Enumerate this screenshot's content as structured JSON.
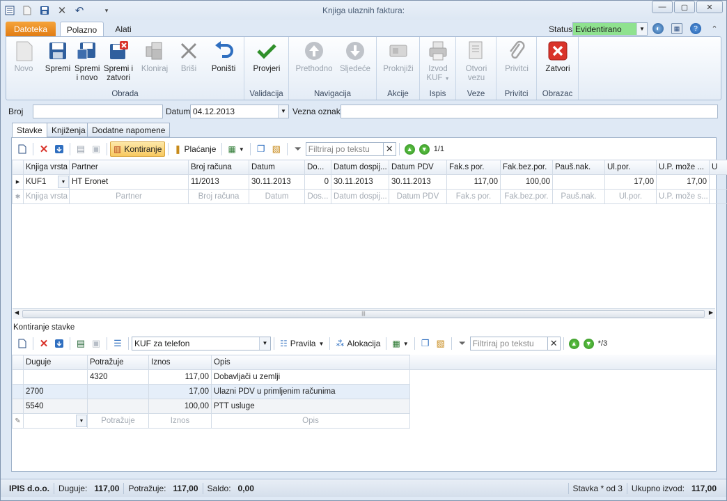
{
  "window": {
    "title": "Knjiga ulaznih faktura:",
    "min_symbol": "—",
    "max_symbol": "▢",
    "close_symbol": "✕"
  },
  "ribbon_tabs": [
    "Datoteka",
    "Polazno",
    "Alati"
  ],
  "status": {
    "label": "Status",
    "value": "Evidentirano"
  },
  "ribbon": {
    "groups": [
      "Obrada",
      "Validacija",
      "Navigacija",
      "Akcije",
      "Ispis",
      "Veze",
      "Privitci",
      "Obrazac"
    ],
    "novo": "Novo",
    "spremi": "Spremi",
    "spremi_novo": [
      "Spremi",
      "i novo"
    ],
    "spremi_zatvori": [
      "Spremi i",
      "zatvori"
    ],
    "kloniraj": "Kloniraj",
    "brisi": "Briši",
    "ponisti": "Poništi",
    "provjeri": "Provjeri",
    "prethodno": "Prethodno",
    "sljedece": "Sljedeće",
    "proknjizi": "Proknjiži",
    "izvod_kuf": [
      "Izvod",
      "KUF"
    ],
    "otvori_vezu": [
      "Otvori",
      "vezu"
    ],
    "privitci": "Privitci",
    "zatvori": "Zatvori"
  },
  "form": {
    "broj_label": "Broj",
    "broj_value": "",
    "datum_label": "Datum",
    "datum_value": "04.12.2013",
    "vezna_label": "Vezna oznaka",
    "vezna_value": ""
  },
  "page_tabs": [
    "Stavke",
    "Knjiženja",
    "Dodatne napomene"
  ],
  "stavke_toolbar": {
    "kontiranje": "Kontiranje",
    "placanje": "Plaćanje",
    "filter_placeholder": "Filtriraj po tekstu",
    "pager": "1/1"
  },
  "stavke_grid": {
    "columns": [
      "Knjiga vrsta",
      "Partner",
      "Broj računa",
      "Datum",
      "Do...",
      "Datum dospij...",
      "Datum PDV",
      "Fak.s por.",
      "Fak.bez.por.",
      "Pauš.nak.",
      "Ul.por.",
      "U.P. može ...",
      "U"
    ],
    "row": [
      "KUF1",
      "HT Eronet",
      "11/2013",
      "30.11.2013",
      "0",
      "30.11.2013",
      "30.11.2013",
      "117,00",
      "100,00",
      "",
      "17,00",
      "17,00"
    ],
    "new_row": [
      "Knjiga vrsta",
      "Partner",
      "Broj računa",
      "Datum",
      "Dos...",
      "Datum dospij...",
      "Datum PDV",
      "Fak.s por.",
      "Fak.bez.por.",
      "Pauš.nak.",
      "Ul.por.",
      "U.P. može s..."
    ]
  },
  "kontiranje": {
    "title": "Kontiranje stavke",
    "template": "KUF za telefon",
    "pravila": "Pravila",
    "alokacija": "Alokacija",
    "filter_placeholder": "Filtriraj po tekstu",
    "pager": "*/3",
    "columns": [
      "Duguje",
      "Potražuje",
      "Iznos",
      "Opis"
    ],
    "rows": [
      {
        "duguje": "",
        "potrazuje": "4320",
        "iznos": "117,00",
        "opis": "Dobavljači u zemlji"
      },
      {
        "duguje": "2700",
        "potrazuje": "",
        "iznos": "17,00",
        "opis": "Ulazni PDV u primljenim računima"
      },
      {
        "duguje": "5540",
        "potrazuje": "",
        "iznos": "100,00",
        "opis": "PTT usluge"
      }
    ],
    "new_row": {
      "potrazuje": "Potražuje",
      "iznos": "Iznos",
      "opis": "Opis"
    }
  },
  "statusbar": {
    "company": "IPIS d.o.o.",
    "duguje_label": "Duguje:",
    "duguje_value": "117,00",
    "potrazuje_label": "Potražuje:",
    "potrazuje_value": "117,00",
    "saldo_label": "Saldo:",
    "saldo_value": "0,00",
    "stavka": "Stavka * od 3",
    "ukupno_label": "Ukupno izvod:",
    "ukupno_value": "117,00"
  }
}
